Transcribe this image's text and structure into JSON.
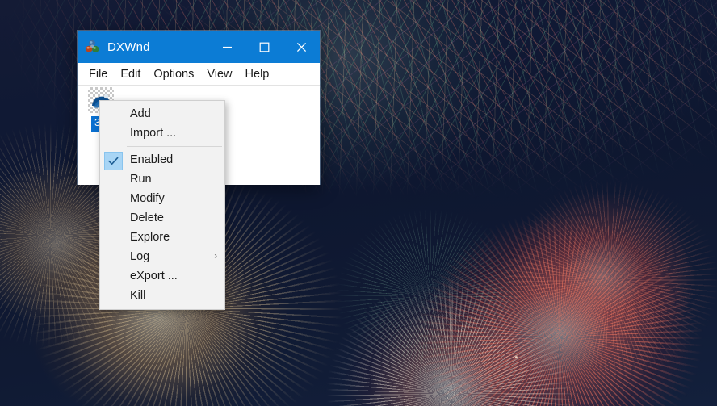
{
  "window": {
    "title": "DXWnd",
    "icon": "dxwnd-spheres-icon",
    "controls": {
      "minimize": "–",
      "maximize": "□",
      "close": "✕"
    },
    "accent_color": "#0c7cd5",
    "selection_color": "#0a70d0"
  },
  "menubar": {
    "items": [
      {
        "label": "File"
      },
      {
        "label": "Edit"
      },
      {
        "label": "Options"
      },
      {
        "label": "View"
      },
      {
        "label": "Help"
      }
    ]
  },
  "client": {
    "entries": [
      {
        "label": "3D",
        "icon": "app-tile-icon",
        "selected": true
      }
    ]
  },
  "context_menu": {
    "items": [
      {
        "label": "Add",
        "checked": false,
        "submenu": false,
        "separator_after": false
      },
      {
        "label": "Import ...",
        "checked": false,
        "submenu": false,
        "separator_after": true
      },
      {
        "label": "Enabled",
        "checked": true,
        "submenu": false,
        "separator_after": false
      },
      {
        "label": "Run",
        "checked": false,
        "submenu": false,
        "separator_after": false
      },
      {
        "label": "Modify",
        "checked": false,
        "submenu": false,
        "separator_after": false
      },
      {
        "label": "Delete",
        "checked": false,
        "submenu": false,
        "separator_after": false
      },
      {
        "label": "Explore",
        "checked": false,
        "submenu": false,
        "separator_after": false
      },
      {
        "label": "Log",
        "checked": false,
        "submenu": true,
        "separator_after": false
      },
      {
        "label": "eXport ...",
        "checked": false,
        "submenu": false,
        "separator_after": false
      },
      {
        "label": "Kill",
        "checked": false,
        "submenu": false,
        "separator_after": false
      }
    ],
    "check_glyph": "✓",
    "submenu_glyph": "›",
    "highlight_color": "#a8d5f5"
  },
  "desktop": {
    "wallpaper_description": "fireworks night sky photograph"
  }
}
